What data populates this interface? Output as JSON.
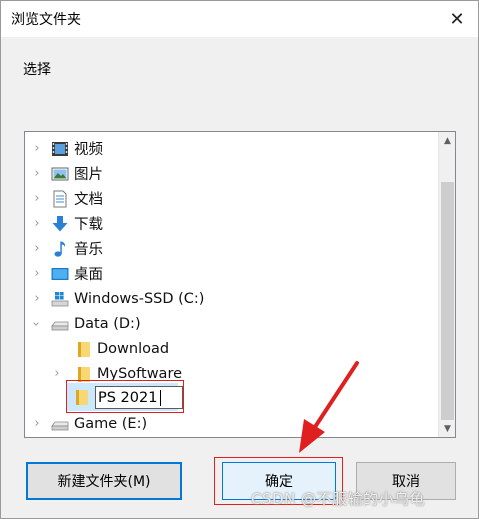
{
  "window": {
    "title": "浏览文件夹",
    "close_symbol": "✕",
    "prompt": "选择"
  },
  "tree": {
    "items": [
      {
        "label": "视频",
        "icon": "video-icon",
        "expander": "collapsed"
      },
      {
        "label": "图片",
        "icon": "pictures-icon",
        "expander": "collapsed"
      },
      {
        "label": "文档",
        "icon": "documents-icon",
        "expander": "collapsed"
      },
      {
        "label": "下载",
        "icon": "downloads-icon",
        "expander": "collapsed"
      },
      {
        "label": "音乐",
        "icon": "music-icon",
        "expander": "collapsed"
      },
      {
        "label": "桌面",
        "icon": "desktop-icon",
        "expander": "collapsed"
      },
      {
        "label": "Windows-SSD (C:)",
        "icon": "windows-drive-icon",
        "expander": "collapsed"
      },
      {
        "label": "Data (D:)",
        "icon": "drive-icon",
        "expander": "expanded"
      },
      {
        "label": "Download",
        "icon": "folder-icon",
        "expander": "none"
      },
      {
        "label": "MySoftware",
        "icon": "folder-icon",
        "expander": "collapsed"
      },
      {
        "label": "PS 2021",
        "icon": "folder-icon",
        "expander": "none",
        "editing": true
      },
      {
        "label": "Game (E:)",
        "icon": "drive-icon",
        "expander": "collapsed"
      }
    ]
  },
  "buttons": {
    "new_folder": "新建文件夹(M)",
    "ok": "确定",
    "cancel": "取消"
  },
  "watermark": "CSDN @不服输的小乌龟",
  "colors": {
    "accent": "#0078d7",
    "annotation_red": "#e02020",
    "selection": "#cce8ff"
  }
}
